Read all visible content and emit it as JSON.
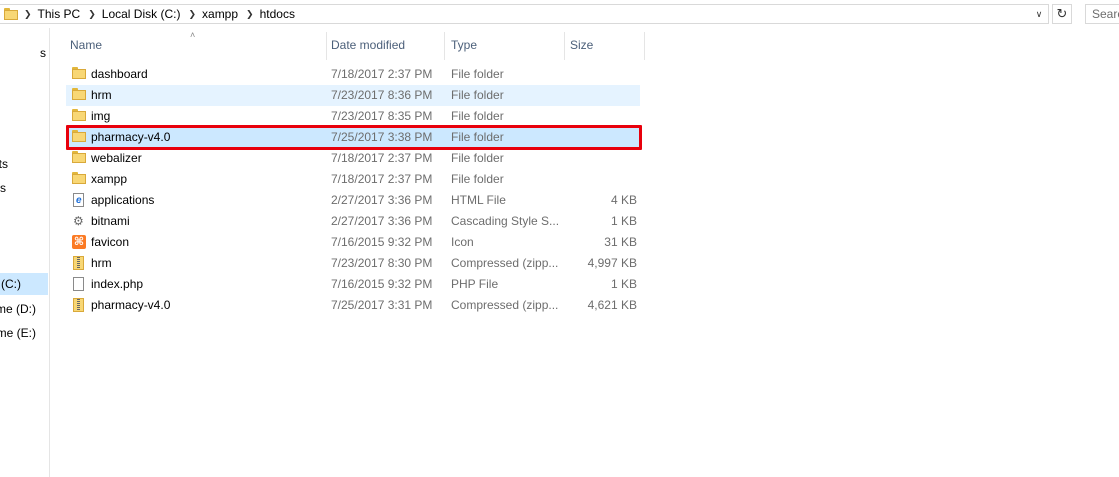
{
  "address": {
    "breadcrumbs": [
      "This PC",
      "Local Disk (C:)",
      "xampp",
      "htdocs"
    ],
    "search_placeholder": "Search"
  },
  "nav": {
    "items": [
      {
        "label": "s"
      },
      {
        "label": "ts"
      },
      {
        "label": "s"
      },
      {
        "label": "(C:)"
      },
      {
        "label": "me (D:)"
      },
      {
        "label": "me (E:)"
      }
    ]
  },
  "columns": {
    "name": "Name",
    "date": "Date modified",
    "type": "Type",
    "size": "Size"
  },
  "files": [
    {
      "name": "dashboard",
      "date": "7/18/2017 2:37 PM",
      "type": "File folder",
      "size": "",
      "icon": "folder-icon"
    },
    {
      "name": "hrm",
      "date": "7/23/2017 8:36 PM",
      "type": "File folder",
      "size": "",
      "icon": "folder-icon"
    },
    {
      "name": "img",
      "date": "7/23/2017 8:35 PM",
      "type": "File folder",
      "size": "",
      "icon": "folder-icon"
    },
    {
      "name": "pharmacy-v4.0",
      "date": "7/25/2017 3:38 PM",
      "type": "File folder",
      "size": "",
      "icon": "folder-icon"
    },
    {
      "name": "webalizer",
      "date": "7/18/2017 2:37 PM",
      "type": "File folder",
      "size": "",
      "icon": "folder-icon"
    },
    {
      "name": "xampp",
      "date": "7/18/2017 2:37 PM",
      "type": "File folder",
      "size": "",
      "icon": "folder-icon"
    },
    {
      "name": "applications",
      "date": "2/27/2017 3:36 PM",
      "type": "HTML File",
      "size": "4 KB",
      "icon": "html-file-icon"
    },
    {
      "name": "bitnami",
      "date": "2/27/2017 3:36 PM",
      "type": "Cascading Style S...",
      "size": "1 KB",
      "icon": "css-file-icon"
    },
    {
      "name": "favicon",
      "date": "7/16/2015 9:32 PM",
      "type": "Icon",
      "size": "31 KB",
      "icon": "xampp-icon"
    },
    {
      "name": "hrm",
      "date": "7/23/2017 8:30 PM",
      "type": "Compressed (zipp...",
      "size": "4,997 KB",
      "icon": "zip-icon"
    },
    {
      "name": "index.php",
      "date": "7/16/2015 9:32 PM",
      "type": "PHP File",
      "size": "1 KB",
      "icon": "file-icon"
    },
    {
      "name": "pharmacy-v4.0",
      "date": "7/25/2017 3:31 PM",
      "type": "Compressed (zipp...",
      "size": "4,621 KB",
      "icon": "zip-icon"
    }
  ],
  "highlight_color": "#e8000c",
  "selection_color": "#cce8ff"
}
